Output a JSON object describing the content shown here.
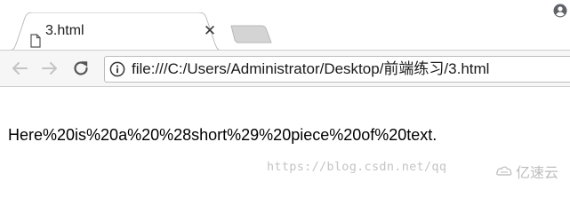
{
  "tab": {
    "title": "3.html",
    "close_glyph": "✕",
    "icon": "file-icon"
  },
  "window": {
    "profile_icon": "profile-icon",
    "new_tab_icon": "new-tab-icon"
  },
  "toolbar": {
    "back_icon": "back-arrow-icon",
    "forward_icon": "forward-arrow-icon",
    "reload_icon": "reload-icon",
    "info_icon": "info-icon",
    "url": "file:///C:/Users/Administrator/Desktop/前端练习/3.html"
  },
  "page": {
    "text": "Here%20is%20a%20%28short%29%20piece%20of%20text."
  },
  "watermark": {
    "url": "https://blog.csdn.net/qq",
    "brand": "亿速云"
  },
  "colors": {
    "tab_active_bg": "#ffffff",
    "toolbar_bg": "#f6f6f6",
    "inactive_tab": "#d4d4d4",
    "border": "#bdbdbd",
    "watermark": "#c4c4c4"
  }
}
